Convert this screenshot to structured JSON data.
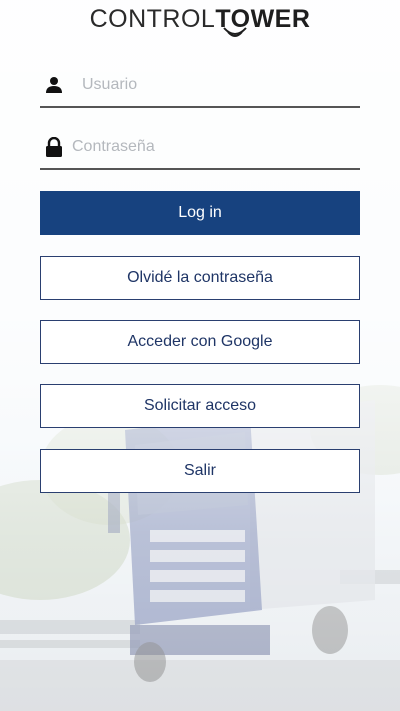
{
  "brand": {
    "logo_light": "CONTROL",
    "logo_bold": "TOWER"
  },
  "login": {
    "username_placeholder": "Usuario",
    "password_placeholder": "Contraseña",
    "login_label": "Log in",
    "forgot_label": "Olvidé la contraseña",
    "google_label": "Acceder con Google",
    "request_access_label": "Solicitar acceso",
    "exit_label": "Salir"
  },
  "icons": {
    "username": "user-icon",
    "password": "lock-icon"
  },
  "colors": {
    "primary": "#17427f",
    "outline_text": "#1f3566",
    "field_line": "#555555"
  }
}
